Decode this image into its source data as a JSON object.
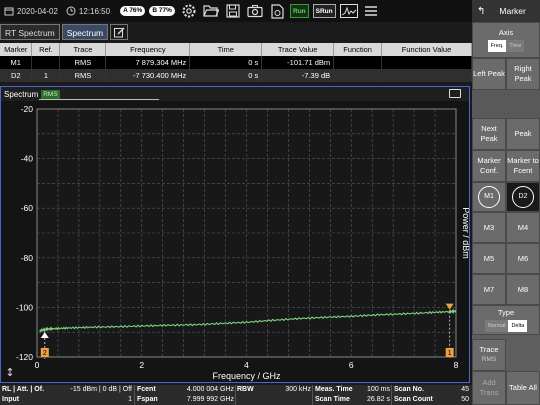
{
  "status": {
    "date": "2020-04-02",
    "time": "12:16:50",
    "battery_a": "A 76%",
    "battery_b": "B 77%",
    "run_label": "Run",
    "srun_label": "SRun"
  },
  "tabs": [
    {
      "label": "RT Spectrum"
    },
    {
      "label": "Spectrum"
    }
  ],
  "marker_table": {
    "headers": [
      "Marker",
      "Ref.",
      "Trace",
      "Frequency",
      "Time",
      "Trace Value",
      "Function",
      "Function Value"
    ],
    "rows": [
      {
        "marker": "M1",
        "ref": "",
        "trace": "RMS",
        "frequency": "7 879.304 MHz",
        "time": "0 s",
        "trace_value": "-101.71 dBm",
        "function": "",
        "function_value": ""
      },
      {
        "marker": "D2",
        "ref": "1",
        "trace": "RMS",
        "frequency": "-7 730.400 MHz",
        "time": "0 s",
        "trace_value": "-7.39 dB",
        "function": "",
        "function_value": ""
      }
    ]
  },
  "spectrum": {
    "title": "Spectrum",
    "trace_tag": "RMS",
    "x_axis_label": "Frequency / GHz",
    "y_axis_label": "Power / dBm",
    "marker_1_label": "1",
    "marker_2_label": "2"
  },
  "chart_data": {
    "type": "line",
    "title": "Spectrum",
    "xlabel": "Frequency / GHz",
    "ylabel": "Power / dBm",
    "xlim": [
      0,
      8
    ],
    "ylim": [
      -120,
      -20
    ],
    "x_ticks": [
      0,
      2,
      4,
      6,
      8
    ],
    "y_ticks": [
      -20,
      -40,
      -60,
      -80,
      -100,
      -120
    ],
    "grid": true,
    "series": [
      {
        "name": "RMS",
        "x": [
          0.05,
          0.15,
          0.3,
          0.6,
          1.0,
          1.5,
          2.0,
          2.5,
          3.0,
          3.5,
          4.0,
          4.5,
          5.0,
          5.5,
          6.0,
          6.5,
          7.0,
          7.5,
          7.88,
          8.0
        ],
        "y": [
          -109.5,
          -108.8,
          -108.6,
          -108.3,
          -108.0,
          -107.8,
          -107.5,
          -107.2,
          -107.0,
          -106.5,
          -106.0,
          -105.2,
          -104.5,
          -104.0,
          -103.6,
          -103.0,
          -102.6,
          -102.1,
          -101.7,
          -101.5
        ]
      }
    ],
    "markers": [
      {
        "name": "1",
        "x": 7.879,
        "y": -101.71
      },
      {
        "name": "2",
        "x": 0.149,
        "y": -109.1
      }
    ]
  },
  "info": {
    "rl_att_of_label": "RL | Att. | Of.",
    "rl_att_of_value": "-15 dBm | 0 dB | Off",
    "input_label": "Input",
    "input_value": "1",
    "fcent_label": "Fcent",
    "fcent_value": "4.000 004 GHz",
    "fspan_label": "Fspan",
    "fspan_value": "7.999 992 GHz",
    "rbw_label": "RBW",
    "rbw_value": "300 kHz",
    "meas_time_label": "Meas. Time",
    "meas_time_value": "100 ms",
    "scan_time_label": "Scan Time",
    "scan_time_value": "26.82 s",
    "scan_no_label": "Scan No.",
    "scan_no_value": "45",
    "scan_count_label": "Scan Count",
    "scan_count_value": "50"
  },
  "right_panel": {
    "title": "Marker",
    "axis_label": "Axis",
    "axis_freq": "Freq.",
    "axis_time": "Time",
    "left_peak": "Left Peak",
    "right_peak": "Right Peak",
    "next_peak": "Next Peak",
    "peak": "Peak",
    "marker_conf": "Marker Conf.",
    "marker_to_fcent": "Marker to Fcent",
    "m1": "M1",
    "d2": "D2",
    "m3": "M3",
    "m4": "M4",
    "m5": "M5",
    "m6": "M6",
    "m7": "M7",
    "m8": "M8",
    "type_label": "Type",
    "type_normal": "Normal",
    "type_delta": "Delta",
    "trace_label": "Trace",
    "trace_value": "RMS",
    "add_trans": "Add Trans",
    "table_all": "Table All"
  },
  "colors": {
    "trace": "#7fd47f",
    "grid": "#5a5a5a",
    "marker": "#f0a040",
    "accent": "#4a66c8"
  }
}
